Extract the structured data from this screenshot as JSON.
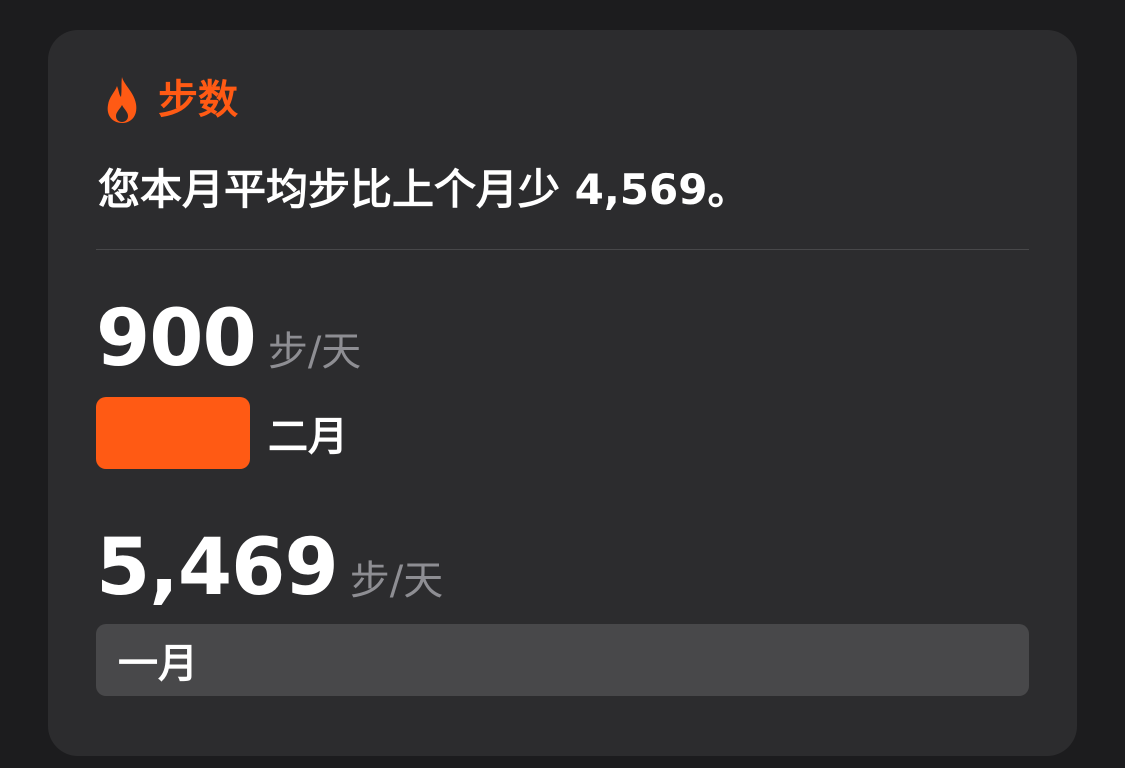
{
  "colors": {
    "accent": "#ff5a14",
    "previous_bar": "#48484a"
  },
  "header": {
    "icon": "flame-icon",
    "title": "步数"
  },
  "summary": "您本月平均步比上个月少 4,569。",
  "months": [
    {
      "value": "900",
      "unit": "步/天",
      "label": "二月",
      "steps": 900
    },
    {
      "value": "5,469",
      "unit": "步/天",
      "label": "一月",
      "steps": 5469
    }
  ]
}
